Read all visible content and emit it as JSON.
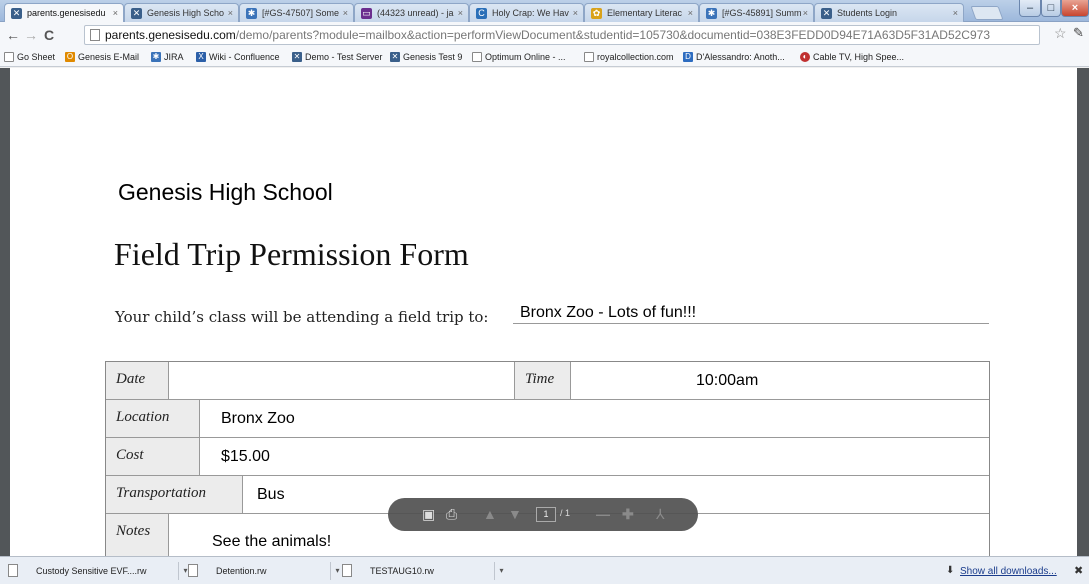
{
  "browser": {
    "tabs": [
      {
        "label": "parents.genesisedu",
        "icon": "genesis-icon",
        "color": "#3a5f8a",
        "active": true
      },
      {
        "label": "Genesis High Scho",
        "icon": "genesis-icon",
        "color": "#3a5f8a"
      },
      {
        "label": "[#GS-47507] Some",
        "icon": "jira-icon",
        "color": "#3b73b9"
      },
      {
        "label": "(44323 unread) - ja",
        "icon": "mail-icon",
        "color": "#6b2d8e"
      },
      {
        "label": "Holy Crap: We Hav",
        "icon": "c-icon",
        "color": "#2a6fb8"
      },
      {
        "label": "Elementary Literac",
        "icon": "literacy-icon",
        "color": "#d9a21b"
      },
      {
        "label": "[#GS-45891] Summ",
        "icon": "jira-icon",
        "color": "#3b73b9"
      },
      {
        "label": "Students Login",
        "icon": "genesis-icon",
        "color": "#3a5f8a"
      }
    ],
    "url_host": "parents.genesisedu.com",
    "url_path": "/demo/parents?module=mailbox&action=performViewDocument&studentid=105730&documentid=038E3FEDD0D94E71A63D5F31AD52C973",
    "bookmarks": [
      {
        "label": "Go Sheet",
        "icon": "page-icon",
        "color": "#ffffff"
      },
      {
        "label": "Genesis E-Mail",
        "icon": "outlook-icon",
        "color": "#e08a00"
      },
      {
        "label": "JIRA",
        "icon": "jira-icon",
        "color": "#3b73b9"
      },
      {
        "label": "Wiki - Confluence",
        "icon": "confluence-icon",
        "color": "#2b5fa8"
      },
      {
        "label": "Demo - Test Server",
        "icon": "genesis-icon",
        "color": "#3a5f8a"
      },
      {
        "label": "Genesis Test 9",
        "icon": "genesis-icon",
        "color": "#3a5f8a"
      },
      {
        "label": "Optimum Online - ...",
        "icon": "page-icon",
        "color": "#ffffff"
      },
      {
        "label": "royalcollection.com",
        "icon": "page-icon",
        "color": "#ffffff"
      },
      {
        "label": "D'Alessandro: Anoth...",
        "icon": "blog-icon",
        "color": "#2d6cc0"
      },
      {
        "label": "Cable TV, High Spee...",
        "icon": "optimum-icon",
        "color": "#c03030"
      }
    ]
  },
  "document": {
    "school": "Genesis High School",
    "title": "Field Trip Permission Form",
    "intro": "Your child’s class will be attending a field trip to:",
    "destination": "Bronx Zoo - Lots of fun!!!",
    "fields": {
      "date_label": "Date",
      "date_value": "",
      "time_label": "Time",
      "time_value": "10:00am",
      "location_label": "Location",
      "location_value": "Bronx Zoo",
      "cost_label": "Cost",
      "cost_value": "$15.00",
      "transportation_label": "Transportation",
      "transportation_value": "Bus",
      "notes_label": "Notes",
      "notes_value": "See the animals!"
    }
  },
  "pdf_toolbar": {
    "page_current": "1",
    "page_total": "/ 1"
  },
  "downloads": {
    "items": [
      "Custody Sensitive EVF....rw",
      "Detention.rw",
      "TESTAUG10.rw"
    ],
    "show_all": "Show all downloads..."
  }
}
